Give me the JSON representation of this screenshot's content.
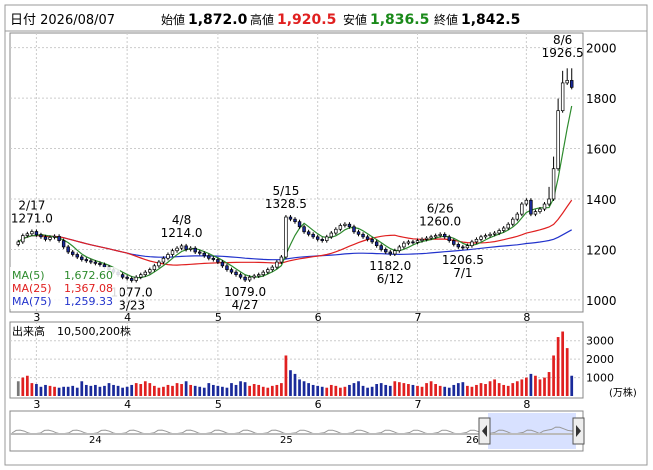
{
  "header": {
    "date_label": "日付 2026/08/07",
    "open_label": "始値",
    "open_value": "1,872.0",
    "high_label": "高値",
    "high_value": "1,920.5",
    "low_label": "安値",
    "low_value": "1,836.5",
    "close_label": "終値",
    "close_value": "1,842.5"
  },
  "colors": {
    "up": "#ffffff",
    "down": "#1a2a9a",
    "ma5": "#2e8b2e",
    "ma25": "#e02020",
    "ma75": "#2233cc",
    "vol_up": "#e02020",
    "vol_down": "#1a2a9a",
    "vol_neutral": "#777777",
    "high_value": "#e02020",
    "low_value": "#1a8a1a",
    "grid": "#cccccc"
  },
  "price_axis": {
    "ticks": [
      "2000",
      "1800",
      "1600",
      "1400",
      "1200",
      "1000"
    ]
  },
  "month_labels": [
    "3",
    "4",
    "5",
    "6",
    "7",
    "8"
  ],
  "legend": {
    "ma5": "MA(5)",
    "ma5_value": "1,672.60",
    "ma25": "MA(25)",
    "ma25_value": "1,367.08",
    "ma75": "MA(75)",
    "ma75_value": "1,259.33"
  },
  "annotations": [
    {
      "date": "2/17",
      "value": "1271.0"
    },
    {
      "date": "3/23",
      "value": "1077.0"
    },
    {
      "date": "4/8",
      "value": "1214.0"
    },
    {
      "date": "4/27",
      "value": "1079.0"
    },
    {
      "date": "5/15",
      "value": "1328.5"
    },
    {
      "date": "6/12",
      "value": "1182.0"
    },
    {
      "date": "6/26",
      "value": "1260.0"
    },
    {
      "date": "7/1",
      "value": "1206.5"
    },
    {
      "date": "8/6",
      "value": "1926.5"
    }
  ],
  "volume": {
    "title": "出来高",
    "value": "10,500,200株",
    "ticks": [
      "3000",
      "2000",
      "1000"
    ],
    "unit": "(万株)"
  },
  "overview": {
    "labels": [
      "24",
      "25",
      "26"
    ]
  },
  "chart_data": {
    "type": "candlestick",
    "ylim": [
      960,
      2050
    ],
    "x_months": [
      "3",
      "4",
      "5",
      "6",
      "7",
      "8"
    ],
    "notes_ohlc": "approximate daily closes read from the chart",
    "closes": [
      1230,
      1255,
      1262,
      1271,
      1258,
      1250,
      1240,
      1248,
      1252,
      1235,
      1210,
      1190,
      1180,
      1170,
      1160,
      1155,
      1150,
      1145,
      1140,
      1130,
      1120,
      1110,
      1100,
      1090,
      1085,
      1077,
      1090,
      1100,
      1110,
      1120,
      1135,
      1150,
      1165,
      1180,
      1195,
      1205,
      1214,
      1200,
      1205,
      1190,
      1185,
      1175,
      1165,
      1160,
      1150,
      1135,
      1120,
      1110,
      1100,
      1090,
      1079,
      1090,
      1095,
      1100,
      1110,
      1120,
      1130,
      1150,
      1170,
      1328.5,
      1320,
      1310,
      1290,
      1270,
      1260,
      1250,
      1240,
      1235,
      1250,
      1265,
      1280,
      1295,
      1300,
      1290,
      1270,
      1260,
      1250,
      1240,
      1230,
      1215,
      1200,
      1190,
      1182,
      1195,
      1210,
      1225,
      1230,
      1228,
      1235,
      1240,
      1245,
      1250,
      1255,
      1260,
      1250,
      1235,
      1220,
      1210,
      1206.5,
      1215,
      1230,
      1240,
      1250,
      1255,
      1260,
      1265,
      1275,
      1285,
      1300,
      1320,
      1340,
      1380,
      1395,
      1340,
      1350,
      1360,
      1380,
      1400,
      1520,
      1750,
      1860,
      1870,
      1842.5
    ],
    "ma25_end": 1367.08,
    "ma5_end": 1672.6,
    "ma75_end": 1259.33,
    "volumes": [
      800,
      1000,
      1100,
      700,
      650,
      500,
      600,
      550,
      500,
      450,
      500,
      500,
      550,
      450,
      800,
      600,
      550,
      600,
      500,
      550,
      700,
      600,
      550,
      450,
      500,
      600,
      700,
      650,
      800,
      700,
      550,
      450,
      500,
      600,
      550,
      700,
      650,
      800,
      600,
      550,
      500,
      450,
      700,
      600,
      550,
      500,
      450,
      700,
      600,
      800,
      750,
      550,
      650,
      600,
      500,
      450,
      550,
      600,
      700,
      2200,
      1400,
      1200,
      900,
      800,
      700,
      600,
      550,
      500,
      450,
      600,
      550,
      450,
      500,
      600,
      700,
      800,
      550,
      450,
      500,
      650,
      700,
      600,
      550,
      800,
      750,
      700,
      650,
      600,
      550,
      500,
      700,
      800,
      650,
      550,
      500,
      450,
      600,
      700,
      750,
      550,
      500,
      600,
      700,
      650,
      800,
      900,
      700,
      600,
      550,
      700,
      800,
      900,
      1000,
      1200,
      1100,
      900,
      1000,
      1300,
      2200,
      3200,
      3500,
      2600,
      1100
    ]
  }
}
